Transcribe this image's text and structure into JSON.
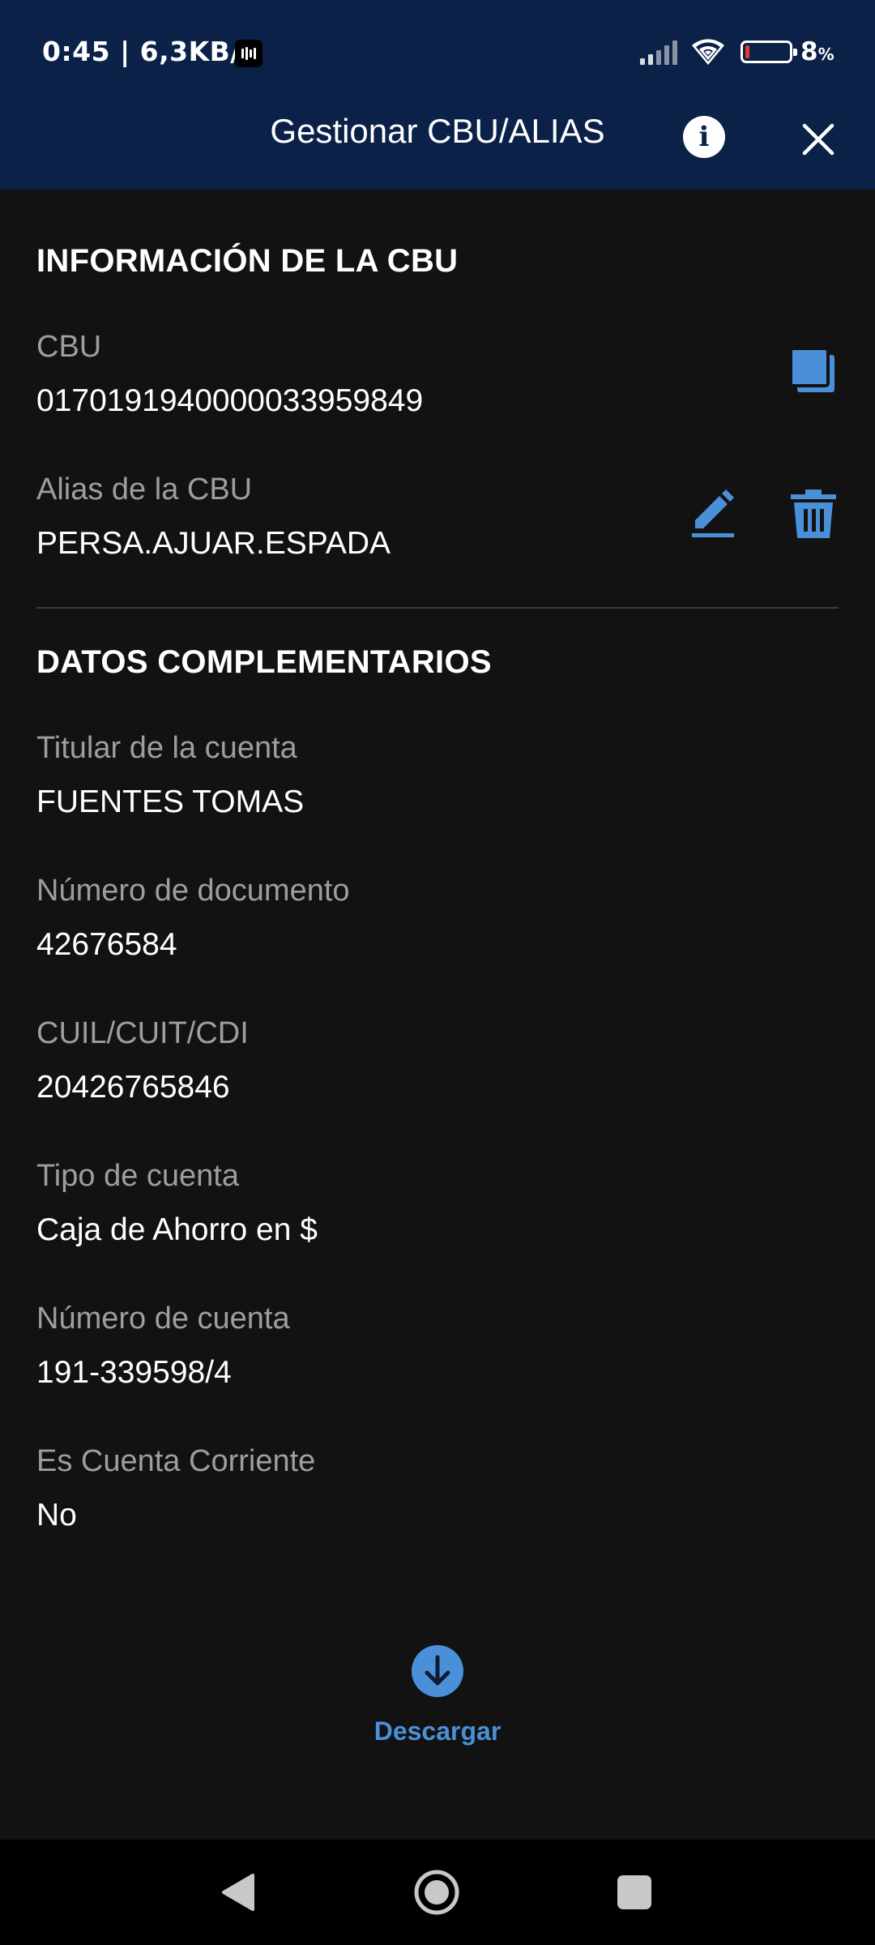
{
  "status_bar": {
    "time_speed": "0:45 | 6,3KB/s",
    "battery_percent": "8",
    "battery_unit": "%",
    "battery_level": 0.08,
    "battery_color": "#e53935"
  },
  "header": {
    "title": "Gestionar CBU/ALIAS",
    "info_icon": "info-icon",
    "close_icon": "close-icon",
    "background": "#0b2148"
  },
  "cbu_section": {
    "title": "INFORMACIÓN DE LA CBU",
    "cbu_label": "CBU",
    "cbu_value": "0170191940000033959849",
    "copy_icon": "copy-icon",
    "alias_label": "Alias de la CBU",
    "alias_value": "PERSA.AJUAR.ESPADA",
    "edit_icon": "edit-pencil-icon",
    "delete_icon": "trash-icon"
  },
  "complementary": {
    "title": "DATOS COMPLEMENTARIOS",
    "fields": [
      {
        "label": "Titular de la cuenta",
        "value": "FUENTES TOMAS"
      },
      {
        "label": "Número de documento",
        "value": "42676584"
      },
      {
        "label": "CUIL/CUIT/CDI",
        "value": "20426765846"
      },
      {
        "label": "Tipo de cuenta",
        "value": "Caja de Ahorro en $"
      },
      {
        "label": "Número de cuenta",
        "value": "191-339598/4"
      },
      {
        "label": "Es Cuenta Corriente",
        "value": "No"
      }
    ]
  },
  "download": {
    "label": "Descargar",
    "icon": "download-arrow-icon",
    "accent": "#4a90d9"
  },
  "nav_bar": {
    "back_icon": "back-triangle-icon",
    "home_icon": "home-circle-icon",
    "recent_icon": "recent-apps-square-icon"
  }
}
